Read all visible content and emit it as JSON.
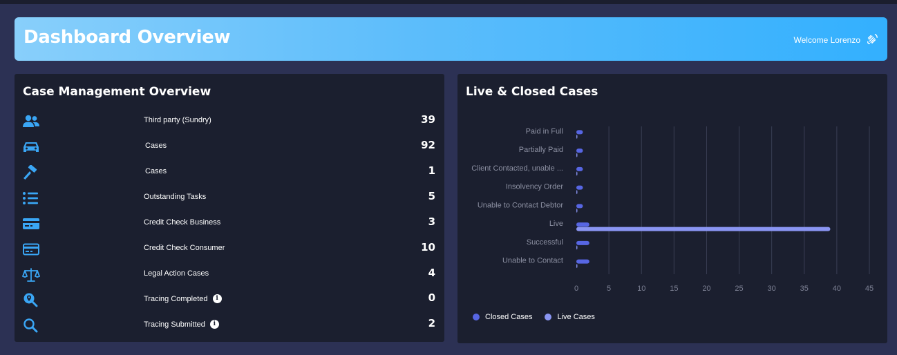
{
  "header": {
    "title": "Dashboard Overview",
    "welcome": "Welcome Lorenzo"
  },
  "case_management": {
    "title": "Case Management Overview",
    "rows": [
      {
        "icon": "users-icon",
        "label": "Third party (Sundry)",
        "value": "39",
        "info": false
      },
      {
        "icon": "car-icon",
        "label": "Cases",
        "value": "92",
        "info": false
      },
      {
        "icon": "gavel-icon",
        "label": "Cases",
        "value": "1",
        "info": false
      },
      {
        "icon": "list-icon",
        "label": "Outstanding Tasks",
        "value": "5",
        "info": false
      },
      {
        "icon": "credit-card-icon",
        "label": "Credit Check Business",
        "value": "3",
        "info": false
      },
      {
        "icon": "credit-card-outline-icon",
        "label": "Credit Check Consumer",
        "value": "10",
        "info": false
      },
      {
        "icon": "scales-icon",
        "label": "Legal Action Cases",
        "value": "4",
        "info": false
      },
      {
        "icon": "search-location-icon",
        "label": "Tracing Completed",
        "value": "0",
        "info": true
      },
      {
        "icon": "search-icon",
        "label": "Tracing Submitted",
        "value": "2",
        "info": true
      }
    ]
  },
  "colors": {
    "accent": "#3aa6f5",
    "closed": "#5766e3",
    "live": "#8a95f2"
  },
  "chart_data": {
    "type": "bar",
    "orientation": "horizontal",
    "title": "Live & Closed Cases",
    "categories": [
      "Paid in Full",
      "Partially Paid",
      "Client Contacted, unable ...",
      "Insolvency Order",
      "Unable to Contact Debtor",
      "Live",
      "Successful",
      "Unable to Contact"
    ],
    "series": [
      {
        "name": "Closed Cases",
        "color": "#5766e3",
        "values": [
          1,
          1,
          1,
          1,
          1,
          2,
          2,
          2
        ]
      },
      {
        "name": "Live Cases",
        "color": "#8a95f2",
        "values": [
          0,
          0,
          0,
          0,
          0,
          39,
          0,
          0
        ]
      }
    ],
    "xlim": [
      0,
      45
    ],
    "xticks": [
      0,
      5,
      10,
      15,
      20,
      25,
      30,
      35,
      40,
      45
    ],
    "grid": true,
    "legend": "bottom-left"
  }
}
